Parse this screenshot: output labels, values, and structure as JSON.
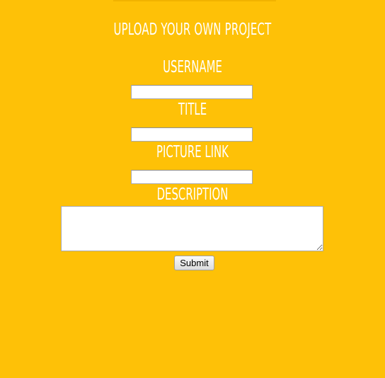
{
  "page": {
    "background_color": "#FEC107",
    "text_color": "#FFFFFF"
  },
  "form": {
    "title": "Upload your own project",
    "fields": [
      {
        "label": "Username",
        "value": "",
        "type": "text"
      },
      {
        "label": "Title",
        "value": "",
        "type": "text"
      },
      {
        "label": "Picture Link",
        "value": "",
        "type": "text"
      },
      {
        "label": "Description",
        "value": "",
        "type": "textarea"
      }
    ],
    "submit_label": "Submit"
  }
}
